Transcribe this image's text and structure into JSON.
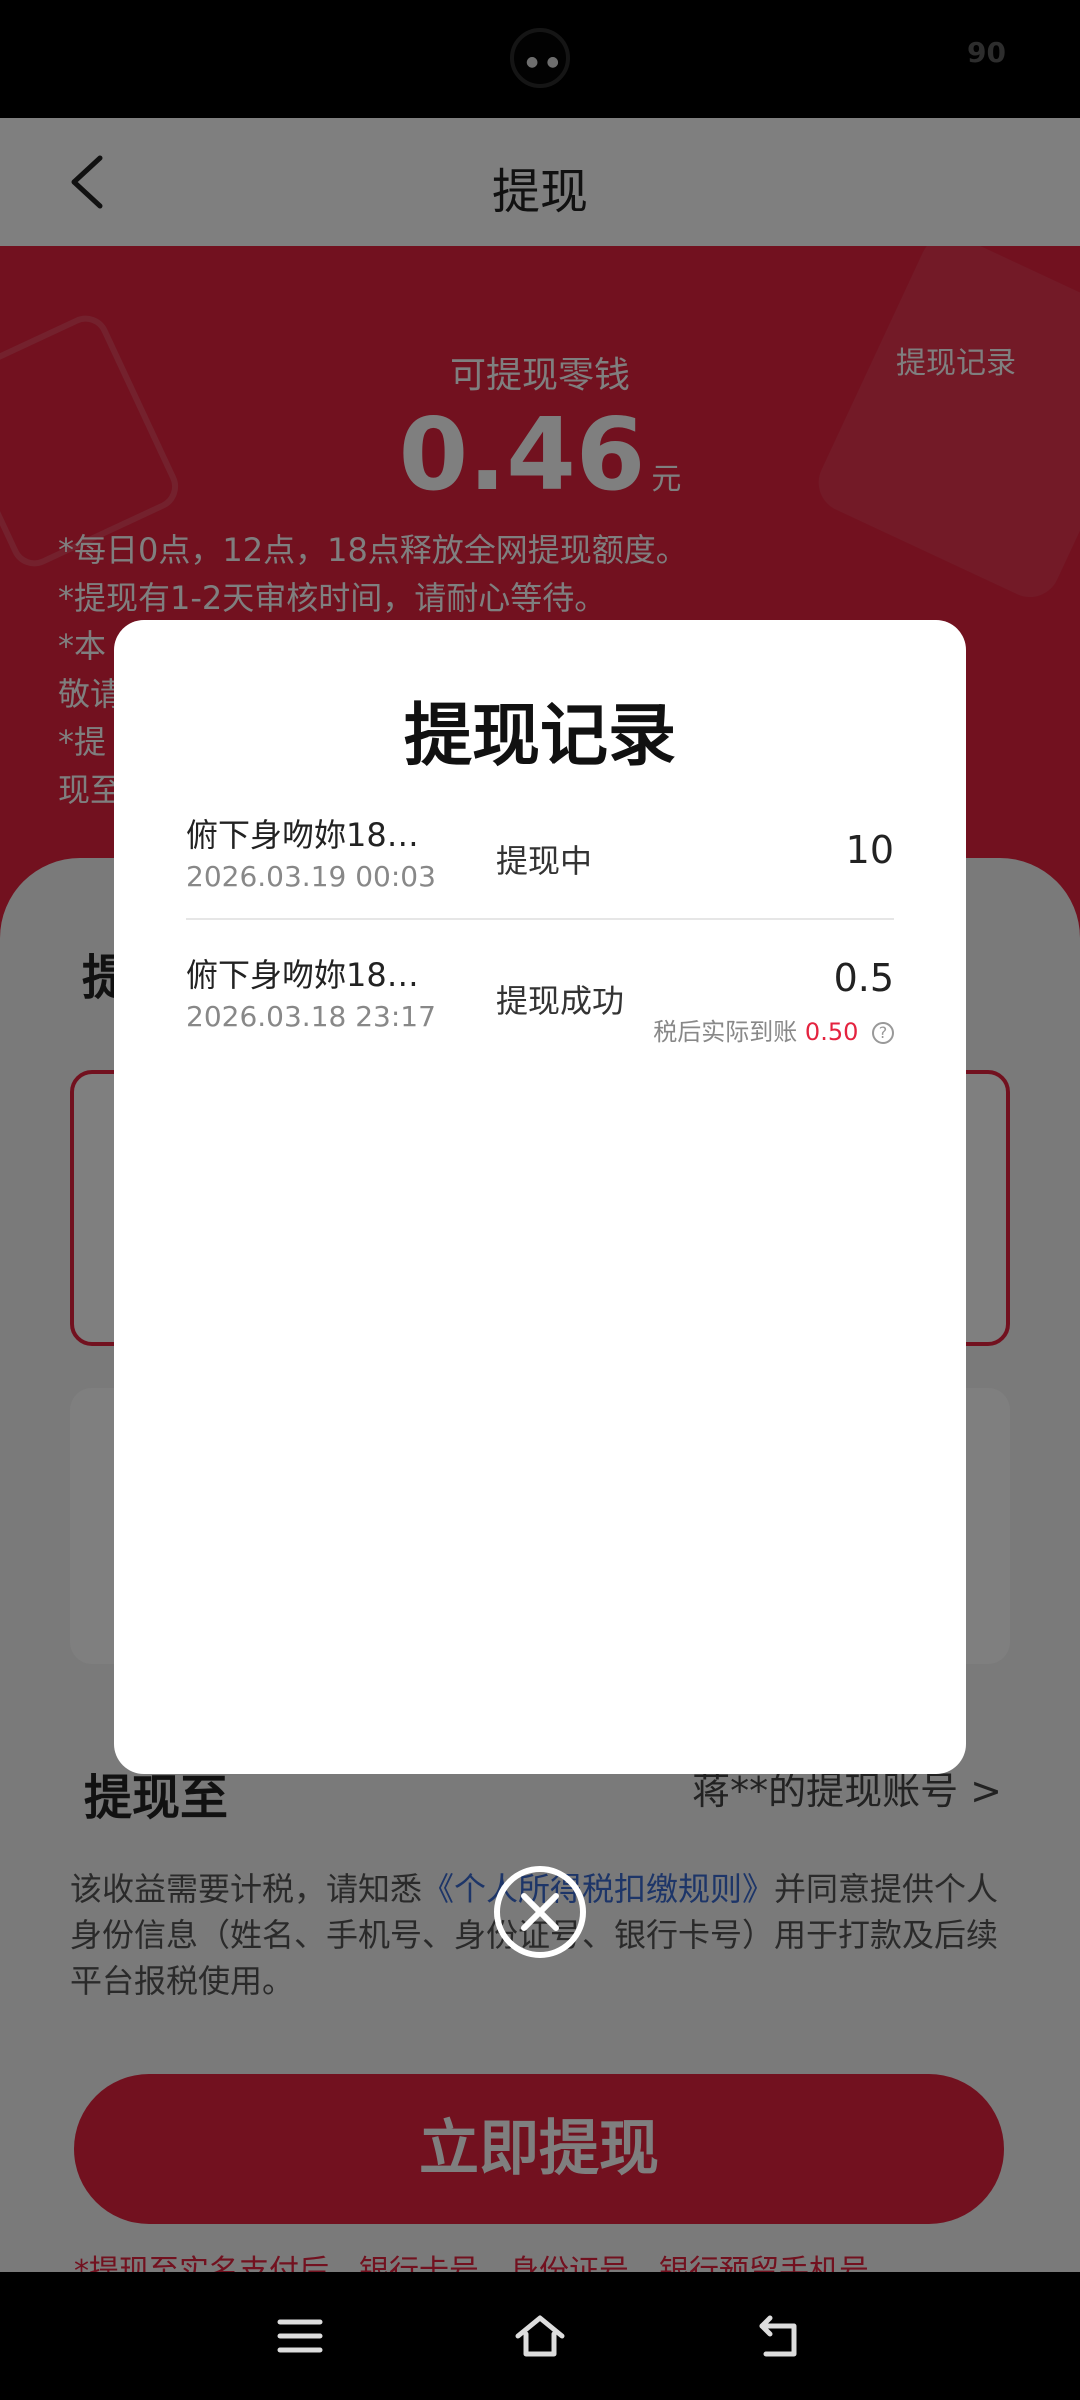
{
  "status_bar": {
    "battery": "90"
  },
  "header": {
    "title": "提现"
  },
  "hero": {
    "available_label": "可提现零钱",
    "amount": "0.46",
    "unit": "元",
    "record_link": "提现记录",
    "notes": [
      "*每日0点，12点，18点释放全网提现额度。",
      "*提现有1-2天审核时间，请耐心等待。",
      "*本",
      "敬请",
      "*提",
      "现至"
    ]
  },
  "form": {
    "section_heading": "提",
    "to_label": "提现至",
    "to_account": "蒋**的提现账号 >",
    "tax_note_prefix": "该收益需要计税，请知悉",
    "tax_note_link": "《个人所得税扣缴规则》",
    "tax_note_suffix": "并同意提供个人身份信息（姓名、手机号、身份证号、银行卡号）用于打款及后续平台报税使用。",
    "submit_label": "立即提现",
    "bottom_note": "*提现至实名支付后，银行卡号、身份证号、银行预留手机号"
  },
  "modal": {
    "title": "提现记录",
    "records": [
      {
        "name": "俯下身吻妳18…",
        "date": "2026.03.19 00:03",
        "status": "提现中",
        "amount": "10"
      },
      {
        "name": "俯下身吻妳18…",
        "date": "2026.03.18 23:17",
        "status": "提现成功",
        "amount": "0.5",
        "net_label": "税后实际到账",
        "net_value": "0.50"
      }
    ]
  },
  "colors": {
    "accent": "#e4233f",
    "link": "#3a6bd1"
  }
}
